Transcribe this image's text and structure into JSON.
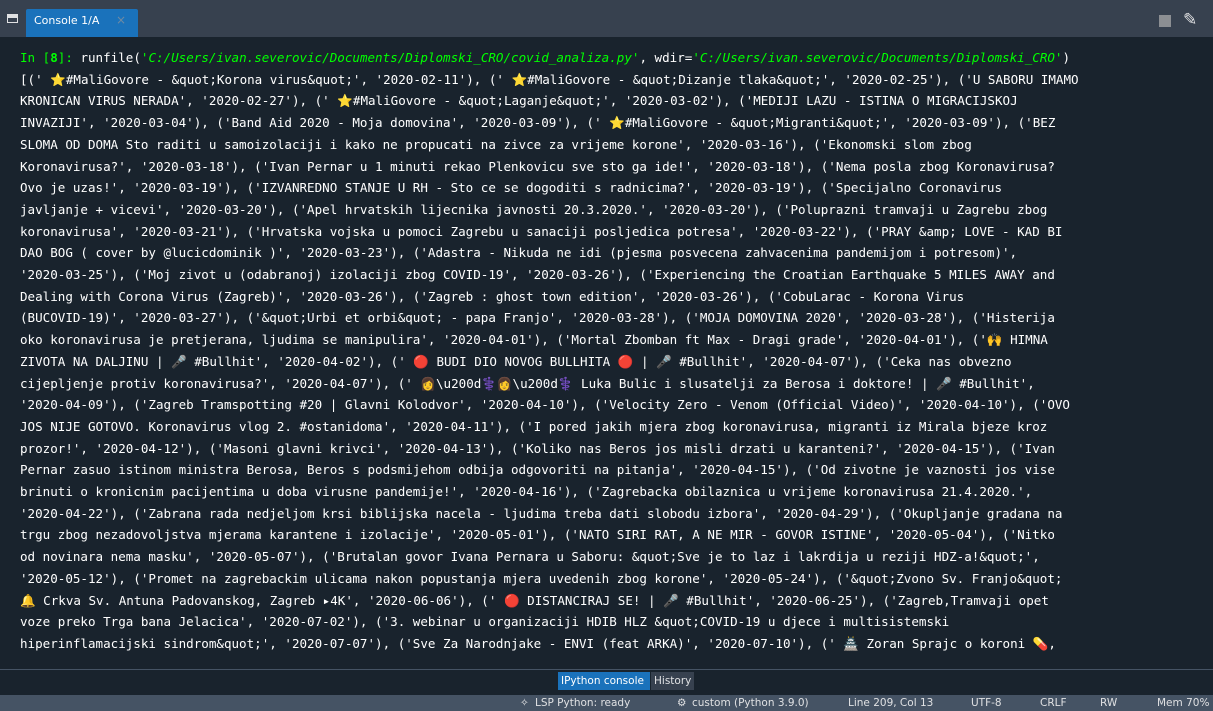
{
  "tab": {
    "title": "Console 1/A",
    "close": "×"
  },
  "console": {
    "prompt_in": "In [",
    "prompt_num": "8",
    "prompt_end": "]:",
    "cmd_pre": " runfile(",
    "cmd_path": "'C:/Users/ivan.severovic/Documents/Diplomski_CRO/covid_analiza.py'",
    "cmd_mid": ", wdir=",
    "cmd_wdir": "'C:/Users/ivan.severovic/Documents/Diplomski_CRO'",
    "cmd_end": ")",
    "output_lines": [
      "[(' ⭐#MaliGovore - &quot;Korona virus&quot;', '2020-02-11'), (' ⭐#MaliGovore - &quot;Dizanje tlaka&quot;', '2020-02-25'), ('U SABORU IMAMO",
      "KRONICAN VIRUS NERADA', '2020-02-27'), (' ⭐#MaliGovore - &quot;Laganje&quot;', '2020-03-02'), ('MEDIJI LAZU - ISTINA O MIGRACIJSKOJ",
      "INVAZIJI', '2020-03-04'), ('Band Aid 2020 - Moja domovina', '2020-03-09'), (' ⭐#MaliGovore - &quot;Migranti&quot;', '2020-03-09'), ('BEZ",
      "SLOMA OD DOMA Sto raditi u samoizolaciji i kako ne propucati na zivce za vrijeme korone', '2020-03-16'), ('Ekonomski slom zbog",
      "Koronavirusa?', '2020-03-18'), ('Ivan Pernar u 1 minuti rekao Plenkovicu sve sto ga ide!', '2020-03-18'), ('Nema posla zbog Koronavirusa?",
      "Ovo je uzas!', '2020-03-19'), ('IZVANREDNO STANJE U RH - Sto ce se dogoditi s radnicima?', '2020-03-19'), ('Specijalno Coronavirus",
      "javljanje + vicevi', '2020-03-20'), ('Apel hrvatskih lijecnika javnosti 20.3.2020.', '2020-03-20'), ('Poluprazni tramvaji u Zagrebu zbog",
      "koronavirusa', '2020-03-21'), ('Hrvatska vojska u pomoci Zagrebu u sanaciji posljedica potresa', '2020-03-22'), ('PRAY &amp; LOVE - KAD BI",
      "DAO BOG ( cover by @lucicdominik )', '2020-03-23'), ('Adastra - Nikuda ne idi (pjesma posvecena zahvacenima pandemijom i potresom)',",
      "'2020-03-25'), ('Moj zivot u (odabranoj) izolaciji zbog COVID-19', '2020-03-26'), ('Experiencing the Croatian Earthquake 5 MILES AWAY and",
      "Dealing with Corona Virus (Zagreb)', '2020-03-26'), ('Zagreb : ghost town edition', '2020-03-26'), ('CobuLarac - Korona Virus",
      "(BUCOVID-19)', '2020-03-27'), ('&quot;Urbi et orbi&quot; - papa Franjo', '2020-03-28'), ('MOJA DOMOVINA 2020', '2020-03-28'), ('Histerija",
      "oko koronavirusa je pretjerana, ljudima se manipulira', '2020-04-01'), ('Mortal Zbomban ft Max - Dragi grade', '2020-04-01'), ('🙌 HIMNA",
      "ZIVOTA NA DALJINU | 🎤 #Bullhit', '2020-04-02'), (' 🔴 BUDI DIO NOVOG BULLHITA 🔴 | 🎤 #Bullhit', '2020-04-07'), ('Ceka nas obvezno",
      "cijepljenje protiv koronavirusa?', '2020-04-07'), (' 👩\\u200d⚕️👩\\u200d⚕️ Luka Bulic i slusatelji za Berosa i doktore! | 🎤 #Bullhit',",
      "'2020-04-09'), ('Zagreb Tramspotting #20 | Glavni Kolodvor', '2020-04-10'), ('Velocity Zero - Venom (Official Video)', '2020-04-10'), ('OVO",
      "JOS NIJE GOTOVO. Koronavirus vlog 2. #ostanidoma', '2020-04-11'), ('I pored jakih mjera zbog koronavirusa, migranti iz Mirala bjeze kroz",
      "prozor!', '2020-04-12'), ('Masoni glavni krivci', '2020-04-13'), ('Koliko nas Beros jos misli drzati u karanteni?', '2020-04-15'), ('Ivan",
      "Pernar zasuo istinom ministra Berosa, Beros s podsmijehom odbija odgovoriti na pitanja', '2020-04-15'), ('Od zivotne je vaznosti jos vise",
      "brinuti o kronicnim pacijentima u doba virusne pandemije!', '2020-04-16'), ('Zagrebacka obilaznica u vrijeme koronavirusa 21.4.2020.',",
      "'2020-04-22'), ('Zabrana rada nedjeljom krsi biblijska nacela - ljudima treba dati slobodu izbora', '2020-04-29'), ('Okupljanje gradana na",
      "trgu zbog nezadovoljstva mjerama karantene i izolacije', '2020-05-01'), ('NATO SIRI RAT, A NE MIR - GOVOR ISTINE', '2020-05-04'), ('Nitko",
      "od novinara nema masku', '2020-05-07'), ('Brutalan govor Ivana Pernara u Saboru: &quot;Sve je to laz i lakrdija u reziji HDZ-a!&quot;',",
      "'2020-05-12'), ('Promet na zagrebackim ulicama nakon popustanja mjera uvedenih zbog korone', '2020-05-24'), ('&quot;Zvono Sv. Franjo&quot;",
      "🔔 Crkva Sv. Antuna Padovanskog, Zagreb ▸4K', '2020-06-06'), (' 🔴 DISTANCIRAJ SE! | 🎤 #Bullhit', '2020-06-25'), ('Zagreb,Tramvaji opet",
      "voze preko Trga bana Jelacica', '2020-07-02'), ('3. webinar u organizaciji HDIB HLZ &quot;COVID-19 u djece i multisistemski",
      "hiperinflamacijski sindrom&quot;', '2020-07-07'), ('Sve Za Narodnjake - ENVI (feat ARKA)', '2020-07-10'), (' 🏯 Zoran Sprajc o koroni 💊,"
    ]
  },
  "bottom_tabs": {
    "ipython": "IPython console",
    "history": "History"
  },
  "status": {
    "lsp": "LSP Python: ready",
    "env": "custom (Python 3.9.0)",
    "position": "Line 209, Col 13",
    "encoding": "UTF-8",
    "eol": "CRLF",
    "rw": "RW",
    "mem": "Mem 70%"
  },
  "colors": {
    "background": "#19232d",
    "accent": "#1a72bb",
    "prompt": "#00ff00"
  }
}
